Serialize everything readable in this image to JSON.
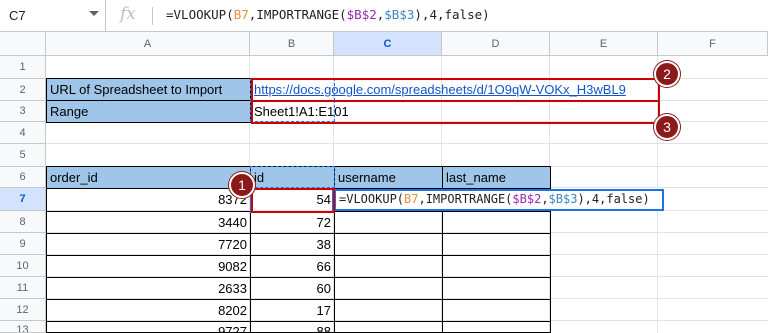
{
  "name_box": {
    "value": "C7"
  },
  "formula_bar": {
    "fx_label": "fx",
    "parts": [
      "=VLOOKUP(",
      "B7",
      ",IMPORTRANGE(",
      "$B$2",
      ",",
      "$B$3",
      "),4,false)"
    ]
  },
  "columns": [
    "A",
    "B",
    "C",
    "D",
    "E",
    "F"
  ],
  "rows": [
    "1",
    "2",
    "3",
    "4",
    "5",
    "6",
    "7",
    "8",
    "9",
    "10",
    "11",
    "12",
    "13"
  ],
  "cells": {
    "a2": "URL of Spreadsheet to Import",
    "b2": "https://docs.google.com/spreadsheets/d/1O9qW-VOKx_H3wBL9",
    "a3": "Range",
    "b3": "Sheet1!A1:E101",
    "a6": "order_id",
    "b6": "id",
    "c6": "username",
    "d6": "last_name"
  },
  "order_ids": [
    "8372",
    "3440",
    "7720",
    "9082",
    "2633",
    "8202",
    "9727"
  ],
  "ids": [
    "54",
    "72",
    "38",
    "66",
    "60",
    "17",
    "88"
  ],
  "editor_formula_parts": [
    "=VLOOKUP(",
    "B7",
    ",IMPORTRANGE(",
    "$B$2",
    ",",
    "$B$3",
    "),4,false)"
  ],
  "badges": [
    "1",
    "2",
    "3"
  ],
  "colors": {
    "header_fill": "#9fc5e8",
    "annotation_red": "#cc0000",
    "badge_fill": "#8b1a1a",
    "selection_blue": "#1a73e8",
    "ref_b7": "#e69138",
    "ref_b2": "#9c27b0",
    "ref_b3": "#3d85c6"
  }
}
